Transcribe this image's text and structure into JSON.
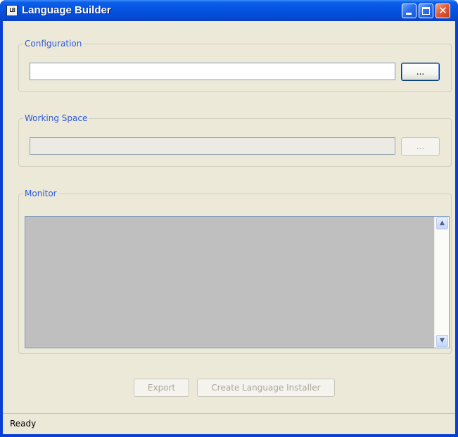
{
  "window": {
    "title": "Language Builder",
    "icon_text": "LB",
    "controls": {
      "minimize": "minimize-icon",
      "maximize": "maximize-icon",
      "close": "close-icon"
    }
  },
  "configuration": {
    "legend": "Configuration",
    "path_value": "",
    "browse_label": "..."
  },
  "working_space": {
    "legend": "Working Space",
    "path_value": "",
    "browse_label": "..."
  },
  "monitor": {
    "legend": "Monitor",
    "content": ""
  },
  "actions": {
    "export_label": "Export",
    "create_installer_label": "Create Language Installer"
  },
  "status": {
    "text": "Ready"
  },
  "colors": {
    "titlebar": "#0552e0",
    "client_bg": "#ece9d8",
    "legend_text": "#2f5bd8",
    "monitor_bg": "#bfbfbf",
    "close_button": "#e45a34"
  }
}
